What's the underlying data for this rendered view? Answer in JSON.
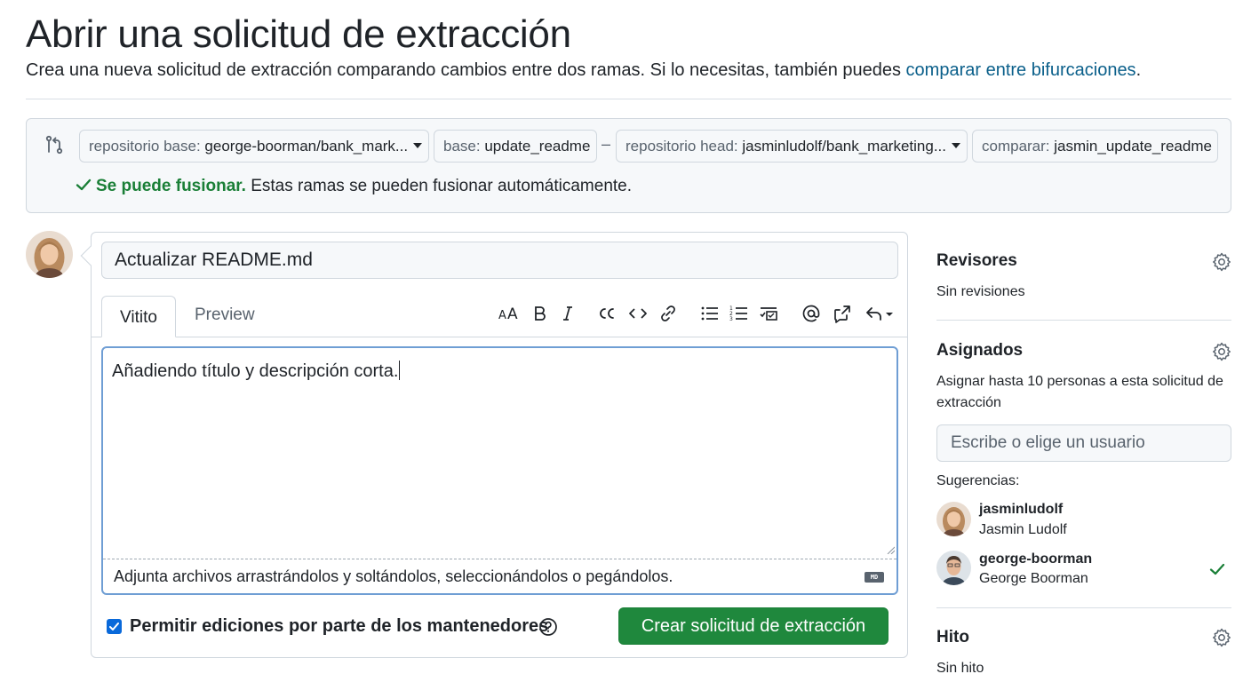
{
  "header": {
    "title": "Abrir una solicitud de extracción",
    "subtitle": "Crea una nueva solicitud de extracción comparando cambios entre dos ramas. Si lo necesitas, también puedes ",
    "subtitle_link": "comparar entre bifurcaciones",
    "subtitle_end": "."
  },
  "compare": {
    "base_repo_label": "repositorio base:",
    "base_repo_value": "george-boorman/bank_mark...",
    "base_label": "base:",
    "base_value": "update_readme",
    "separator": "–",
    "head_repo_label": "repositorio head:",
    "head_repo_value": "jasminludolf/bank_marketing...",
    "compare_label": "comparar:",
    "compare_value": "jasmin_update_readme",
    "merge_ok": "Se puede fusionar.",
    "merge_text": " Estas ramas se pueden fusionar automáticamente.",
    "status_color": "#1a7f37"
  },
  "form": {
    "title_value": "Actualizar README.md",
    "tabs": [
      {
        "label": "Vitito",
        "active": true
      },
      {
        "label": "Preview",
        "active": false
      }
    ],
    "toolbar": [
      "heading-icon",
      "bold-icon",
      "italic-icon",
      "quote-icon",
      "code-icon",
      "link-icon",
      "unordered-list-icon",
      "ordered-list-icon",
      "task-list-icon",
      "mention-icon",
      "reference-icon",
      "undo-icon"
    ],
    "body_value": "Añadiendo título y descripción corta.",
    "attach_text": "Adjunta archivos arrastrándolos y soltándolos, seleccionándolos o pegándolos.",
    "md_badge": "MD",
    "maintainer_edits_label": "Permitir ediciones por parte de los mantenedores",
    "maintainer_edits_checked": true,
    "create_button": "Crear solicitud de extracción",
    "button_color": "#1f883d"
  },
  "sidebar": {
    "reviewers": {
      "heading": "Revisores",
      "value": "Sin revisiones"
    },
    "assignees": {
      "heading": "Asignados",
      "description": "Asignar hasta 10 personas a esta solicitud de extracción",
      "input_placeholder": "Escribe o elige un usuario",
      "suggestions_label": "Sugerencias:",
      "suggestions": [
        {
          "login": "jasminludolf",
          "name": "Jasmin Ludolf",
          "selected": false
        },
        {
          "login": "george-boorman",
          "name": "George Boorman",
          "selected": true
        }
      ]
    },
    "milestone": {
      "heading": "Hito",
      "value": "Sin hito"
    }
  }
}
